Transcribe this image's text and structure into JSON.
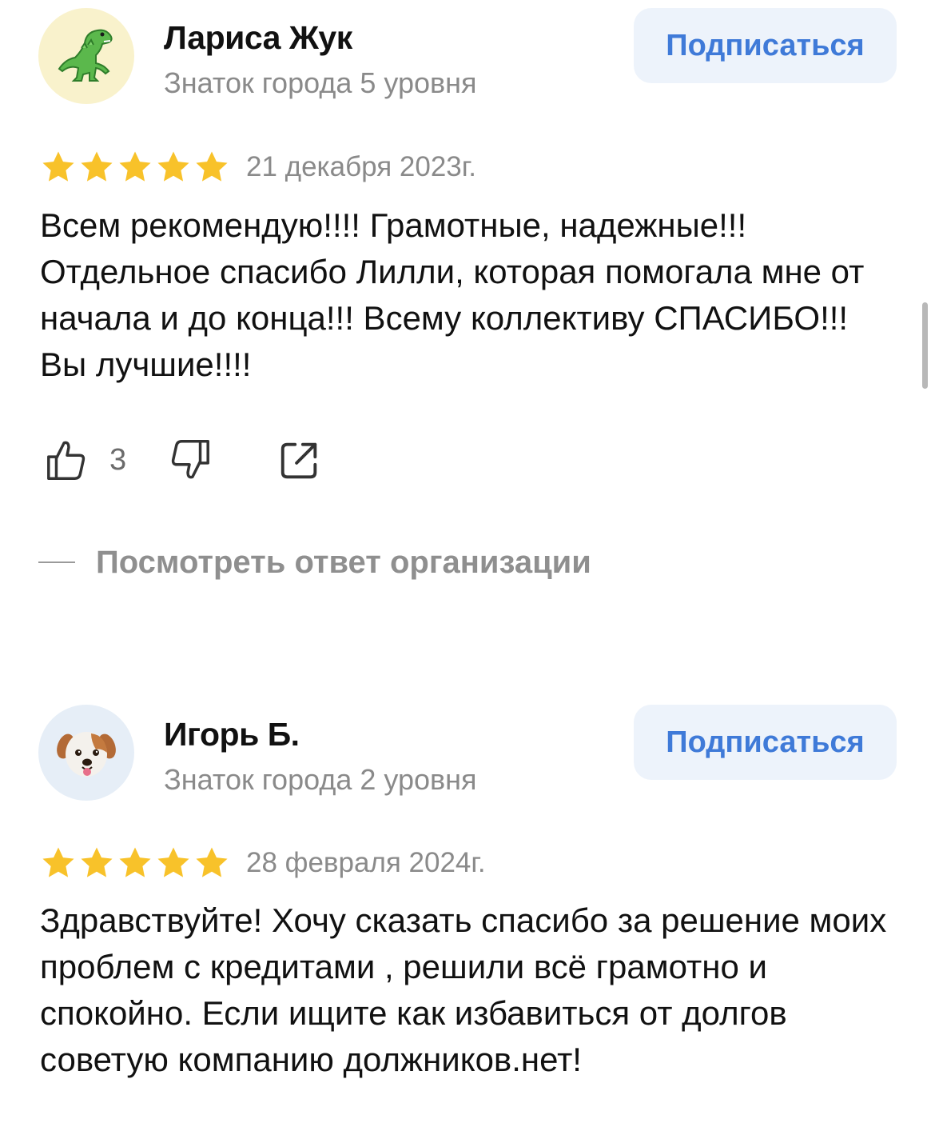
{
  "colors": {
    "accent": "#3f7ad8",
    "button_bg": "#edf3fb",
    "star": "#f8c22a",
    "muted": "#8a8a8a"
  },
  "reviews": [
    {
      "author": "Лариса Жук",
      "level": "Знаток города 5 уровня",
      "avatar_icon": "dinosaur-icon",
      "avatar_bg": "#f9f2cc",
      "subscribe_label": "Подписаться",
      "rating": 5,
      "date": "21 декабря 2023г.",
      "text": "Всем рекомендую!!!! Грамотные, надежные!!! Отдельное спасибо Лилли, которая помогала мне от начала и до конца!!! Всему коллективу СПАСИБО!!! Вы лучшие!!!!",
      "likes": "3",
      "org_response_label": "Посмотреть ответ организации"
    },
    {
      "author": "Игорь Б.",
      "level": "Знаток города 2 уровня",
      "avatar_icon": "puppy-icon",
      "avatar_bg": "#e6eef7",
      "subscribe_label": "Подписаться",
      "rating": 5,
      "date": "28 февраля 2024г.",
      "text": "Здравствуйте! Хочу сказать спасибо за решение моих проблем с кредитами , решили всё грамотно и спокойно. Если ищите как избавиться от долгов советую компанию должников.нет!"
    }
  ]
}
